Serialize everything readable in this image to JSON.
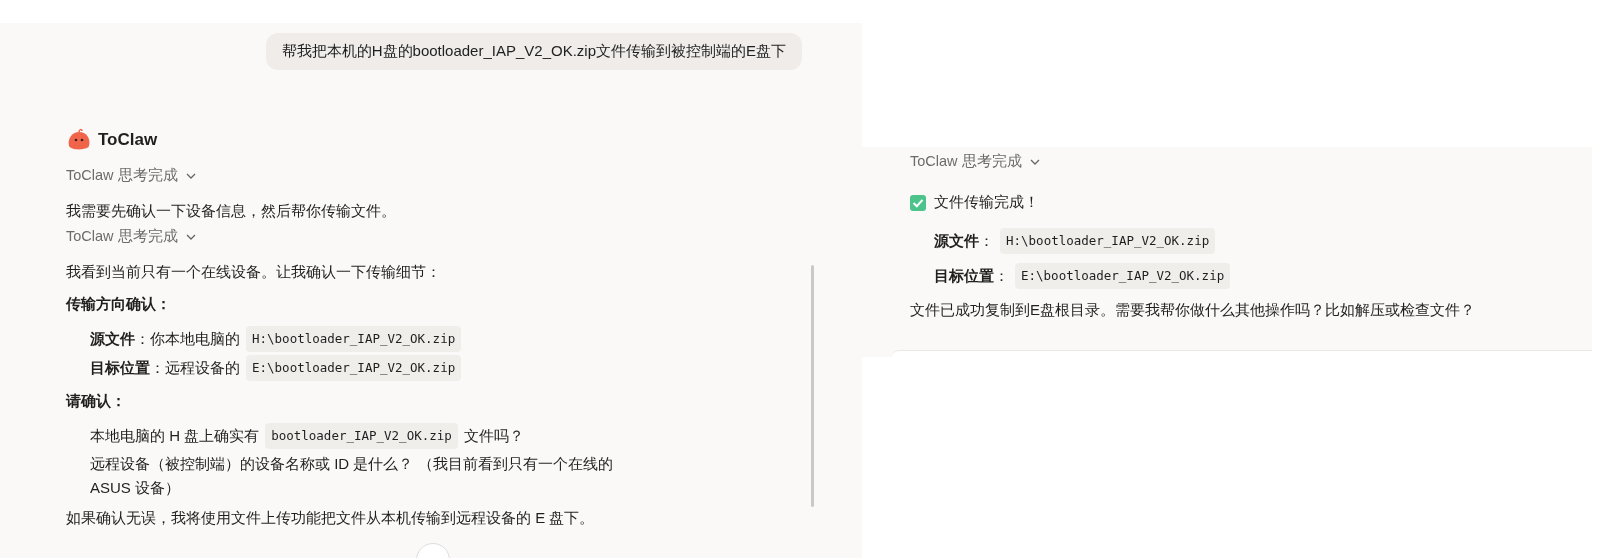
{
  "left_chat": {
    "user_message": "帮我把本机的H盘的bootloader_IAP_V2_OK.zip文件传输到被控制端的E盘下",
    "assistant_name": "ToClaw",
    "blocks": [
      {
        "kind": "thinking",
        "text": "ToClaw 思考完成"
      },
      {
        "kind": "text",
        "text": "我需要先确认一下设备信息，然后帮你传输文件。"
      },
      {
        "kind": "thinking",
        "text": "ToClaw 思考完成"
      },
      {
        "kind": "text",
        "text": "我看到当前只有一个在线设备。让我确认一下传输细节："
      },
      {
        "kind": "heading",
        "text": "传输方向确认："
      },
      {
        "kind": "item",
        "parts": [
          {
            "kind": "text",
            "text": "**源文件**：你本地电脑的"
          },
          {
            "kind": "code",
            "text": "H:\\bootloader_IAP_V2_OK.zip"
          }
        ]
      },
      {
        "kind": "item",
        "parts": [
          {
            "kind": "text",
            "text": "**目标位置**：远程设备的"
          },
          {
            "kind": "code",
            "text": "E:\\bootloader_IAP_V2_OK.zip"
          }
        ]
      },
      {
        "kind": "heading",
        "text": "请确认："
      },
      {
        "kind": "item",
        "parts": [
          {
            "kind": "text",
            "text": "本地电脑的 H 盘上确实有"
          },
          {
            "kind": "code",
            "text": "bootloader_IAP_V2_OK.zip"
          },
          {
            "kind": "text",
            "text": "文件吗？"
          }
        ]
      },
      {
        "kind": "item",
        "parts": [
          {
            "kind": "text",
            "text": "远程设备（被控制端）的设备名称或 ID 是什么？ （我目前看到只有一个在线的 ASUS 设备）"
          }
        ]
      },
      {
        "kind": "text",
        "text": "如果确认无误，我将使用文件上传功能把文件从本机传输到远程设备的 E 盘下。"
      }
    ]
  },
  "right_chat": {
    "blocks": [
      {
        "kind": "thinking",
        "text": "ToClaw 思考完成"
      },
      {
        "kind": "check",
        "text": "文件传输完成！"
      },
      {
        "kind": "item",
        "parts": [
          {
            "kind": "text",
            "text": "**源文件**："
          },
          {
            "kind": "code",
            "text": "H:\\bootloader_IAP_V2_OK.zip"
          }
        ]
      },
      {
        "kind": "item",
        "parts": [
          {
            "kind": "text",
            "text": "**目标位置**："
          },
          {
            "kind": "code",
            "text": "E:\\bootloader_IAP_V2_OK.zip"
          }
        ]
      },
      {
        "kind": "text",
        "text": "文件已成功复制到E盘根目录。需要我帮你做什么其他操作吗？比如解压或检查文件？"
      }
    ]
  }
}
